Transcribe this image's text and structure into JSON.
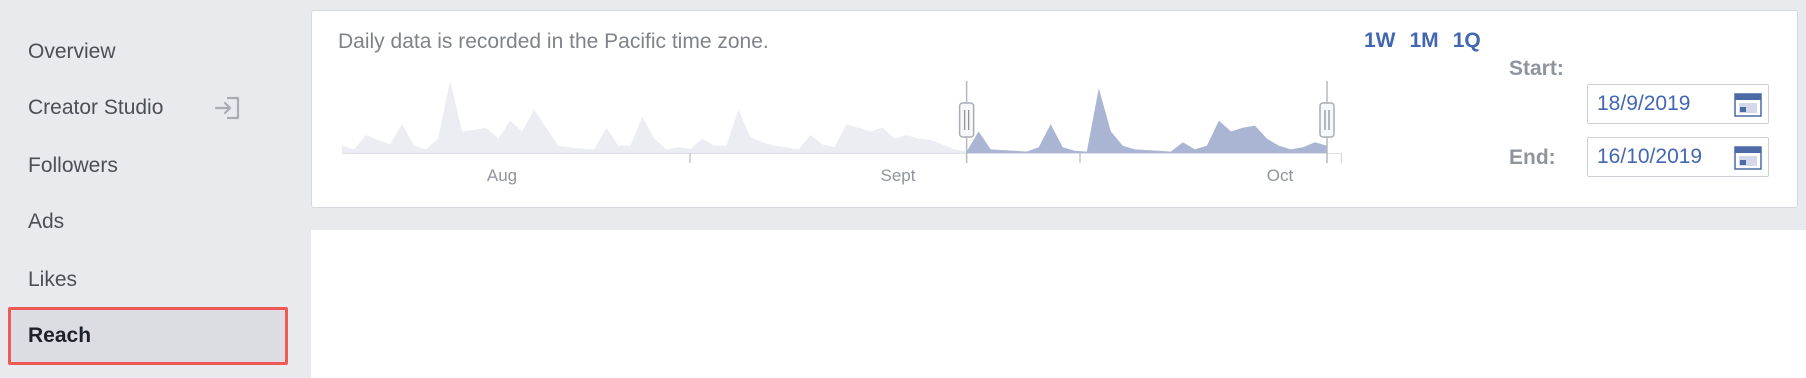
{
  "sidebar": {
    "items": [
      {
        "label": "Overview"
      },
      {
        "label": "Creator Studio"
      },
      {
        "label": "Followers"
      },
      {
        "label": "Ads"
      },
      {
        "label": "Likes"
      },
      {
        "label": "Reach"
      }
    ]
  },
  "card": {
    "note": "Daily data is recorded in the Pacific time zone.",
    "range_buttons": [
      "1W",
      "1M",
      "1Q"
    ],
    "start_label": "Start:",
    "start_value": "18/9/2019",
    "end_label": "End:",
    "end_value": "16/10/2019"
  },
  "colors": {
    "accent": "#4267b2",
    "selected_area": "#aab5d3",
    "unselected_area": "#ebedf3",
    "highlight_border": "#ef5a54"
  },
  "chart_data": {
    "type": "area",
    "x_labels": [
      "Aug",
      "Sept",
      "Oct"
    ],
    "values": [
      0.1,
      0.05,
      0.25,
      0.18,
      0.12,
      0.4,
      0.1,
      0.05,
      0.2,
      1.0,
      0.3,
      0.32,
      0.35,
      0.2,
      0.45,
      0.3,
      0.6,
      0.35,
      0.1,
      0.08,
      0.06,
      0.05,
      0.35,
      0.1,
      0.1,
      0.5,
      0.2,
      0.05,
      0.08,
      0.06,
      0.2,
      0.1,
      0.1,
      0.6,
      0.22,
      0.15,
      0.1,
      0.08,
      0.05,
      0.25,
      0.12,
      0.08,
      0.4,
      0.35,
      0.3,
      0.35,
      0.2,
      0.25,
      0.2,
      0.18,
      0.12,
      0.05,
      0.02,
      0.3,
      0.05,
      0.04,
      0.03,
      0.02,
      0.08,
      0.4,
      0.08,
      0.03,
      0.02,
      0.9,
      0.3,
      0.1,
      0.05,
      0.04,
      0.03,
      0.02,
      0.15,
      0.05,
      0.1,
      0.45,
      0.3,
      0.35,
      0.38,
      0.2,
      0.1,
      0.05,
      0.08,
      0.15,
      0.1
    ],
    "selection_start_index": 52,
    "selection_end_index": 82
  }
}
